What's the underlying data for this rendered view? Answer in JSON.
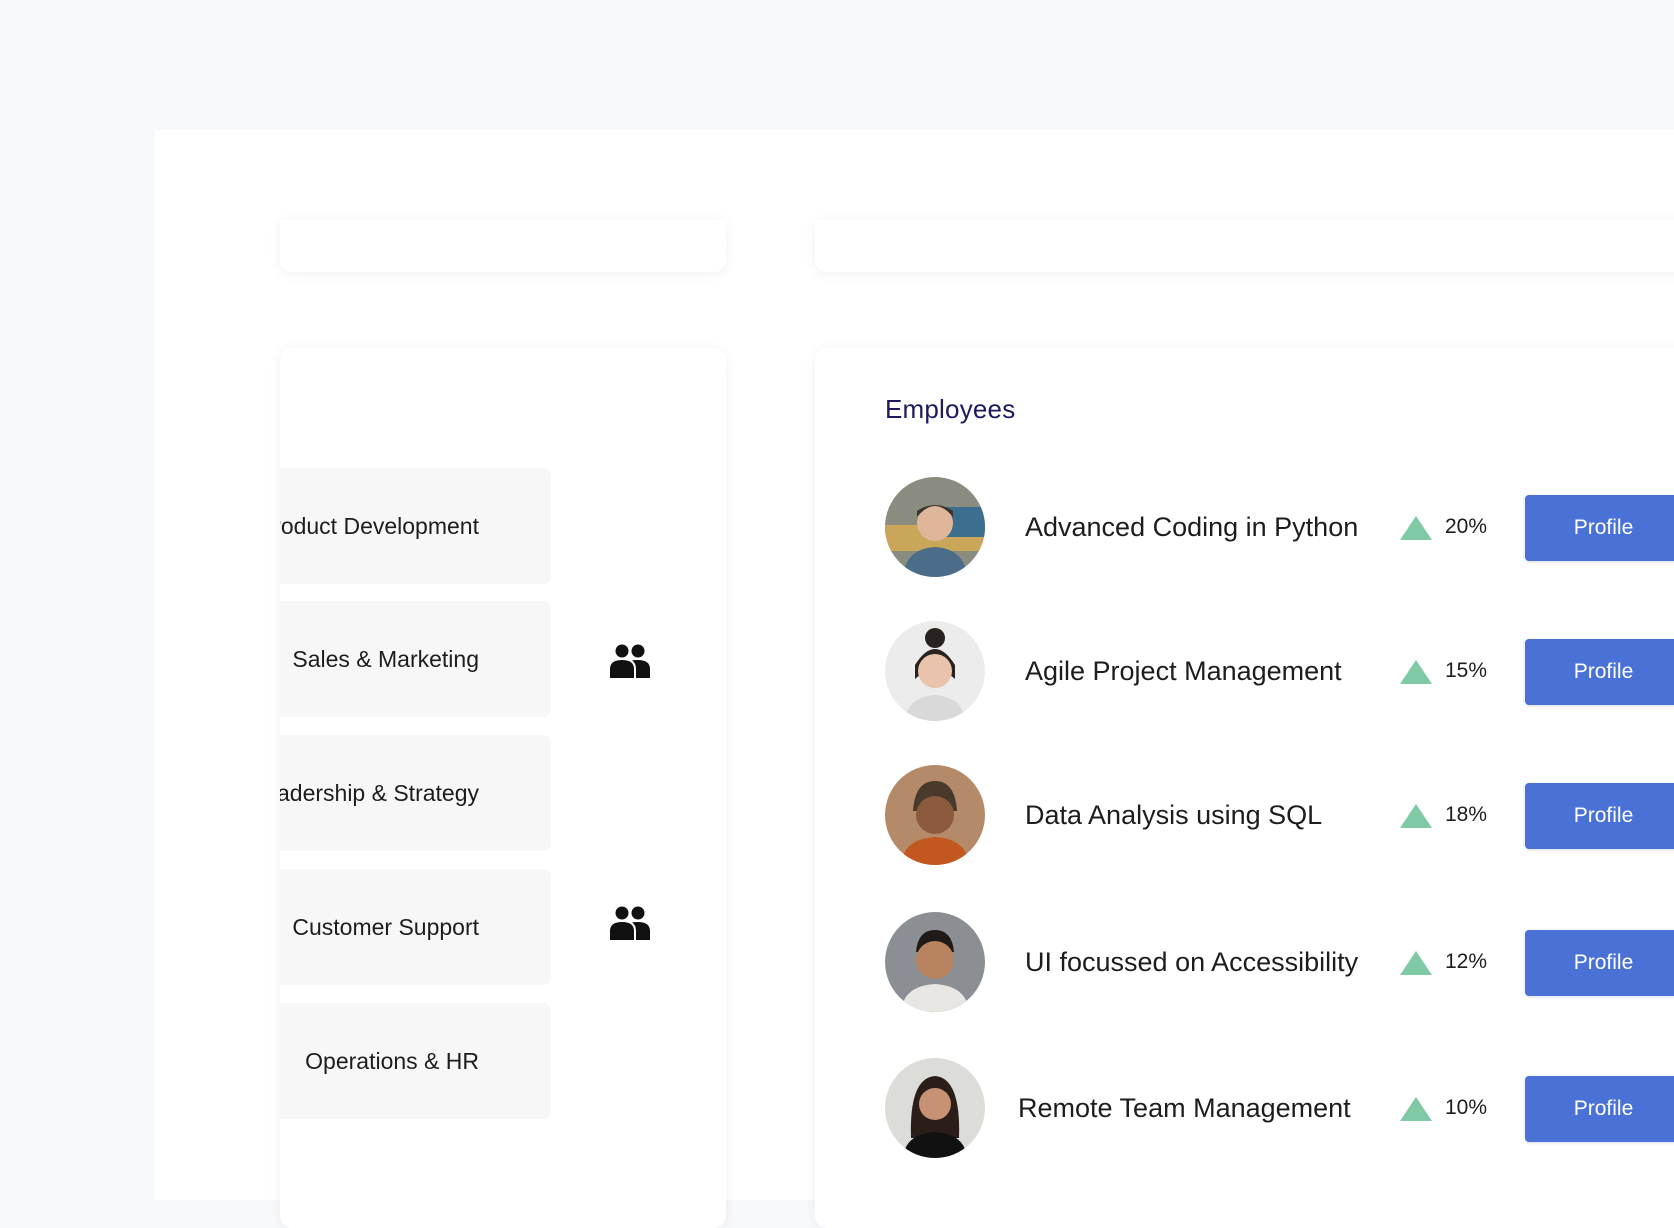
{
  "departments": [
    {
      "label": "Product Development",
      "has_icon": false,
      "icon": ""
    },
    {
      "label": "Sales & Marketing",
      "has_icon": true,
      "icon": "group-icon"
    },
    {
      "label": "Leadership & Strategy",
      "has_icon": false,
      "icon": ""
    },
    {
      "label": "Customer Support",
      "has_icon": true,
      "icon": "group-icon"
    },
    {
      "label": "Operations & HR",
      "has_icon": false,
      "icon": ""
    }
  ],
  "employees_card": {
    "title": "Employees",
    "rows": [
      {
        "course": "Advanced Coding in Python",
        "trend": "20%",
        "trend_icon": "triangle-up-icon",
        "button": "Profile"
      },
      {
        "course": "Agile Project Management",
        "trend": "15%",
        "trend_icon": "triangle-up-icon",
        "button": "Profile"
      },
      {
        "course": "Data Analysis using SQL",
        "trend": "18%",
        "trend_icon": "triangle-up-icon",
        "button": "Profile"
      },
      {
        "course": "UI focussed on Accessibility",
        "trend": "12%",
        "trend_icon": "triangle-up-icon",
        "button": "Profile"
      },
      {
        "course": "Remote Team Management",
        "trend": "10%",
        "trend_icon": "triangle-up-icon",
        "button": "Profile"
      }
    ]
  },
  "colors": {
    "title": "#1c1a5e",
    "button": "#4a72d6",
    "trend_up": "#7fc9a4",
    "page_bg": "#f8f9fb",
    "card_bg": "#ffffff",
    "dept_bg": "#f7f7f8"
  }
}
